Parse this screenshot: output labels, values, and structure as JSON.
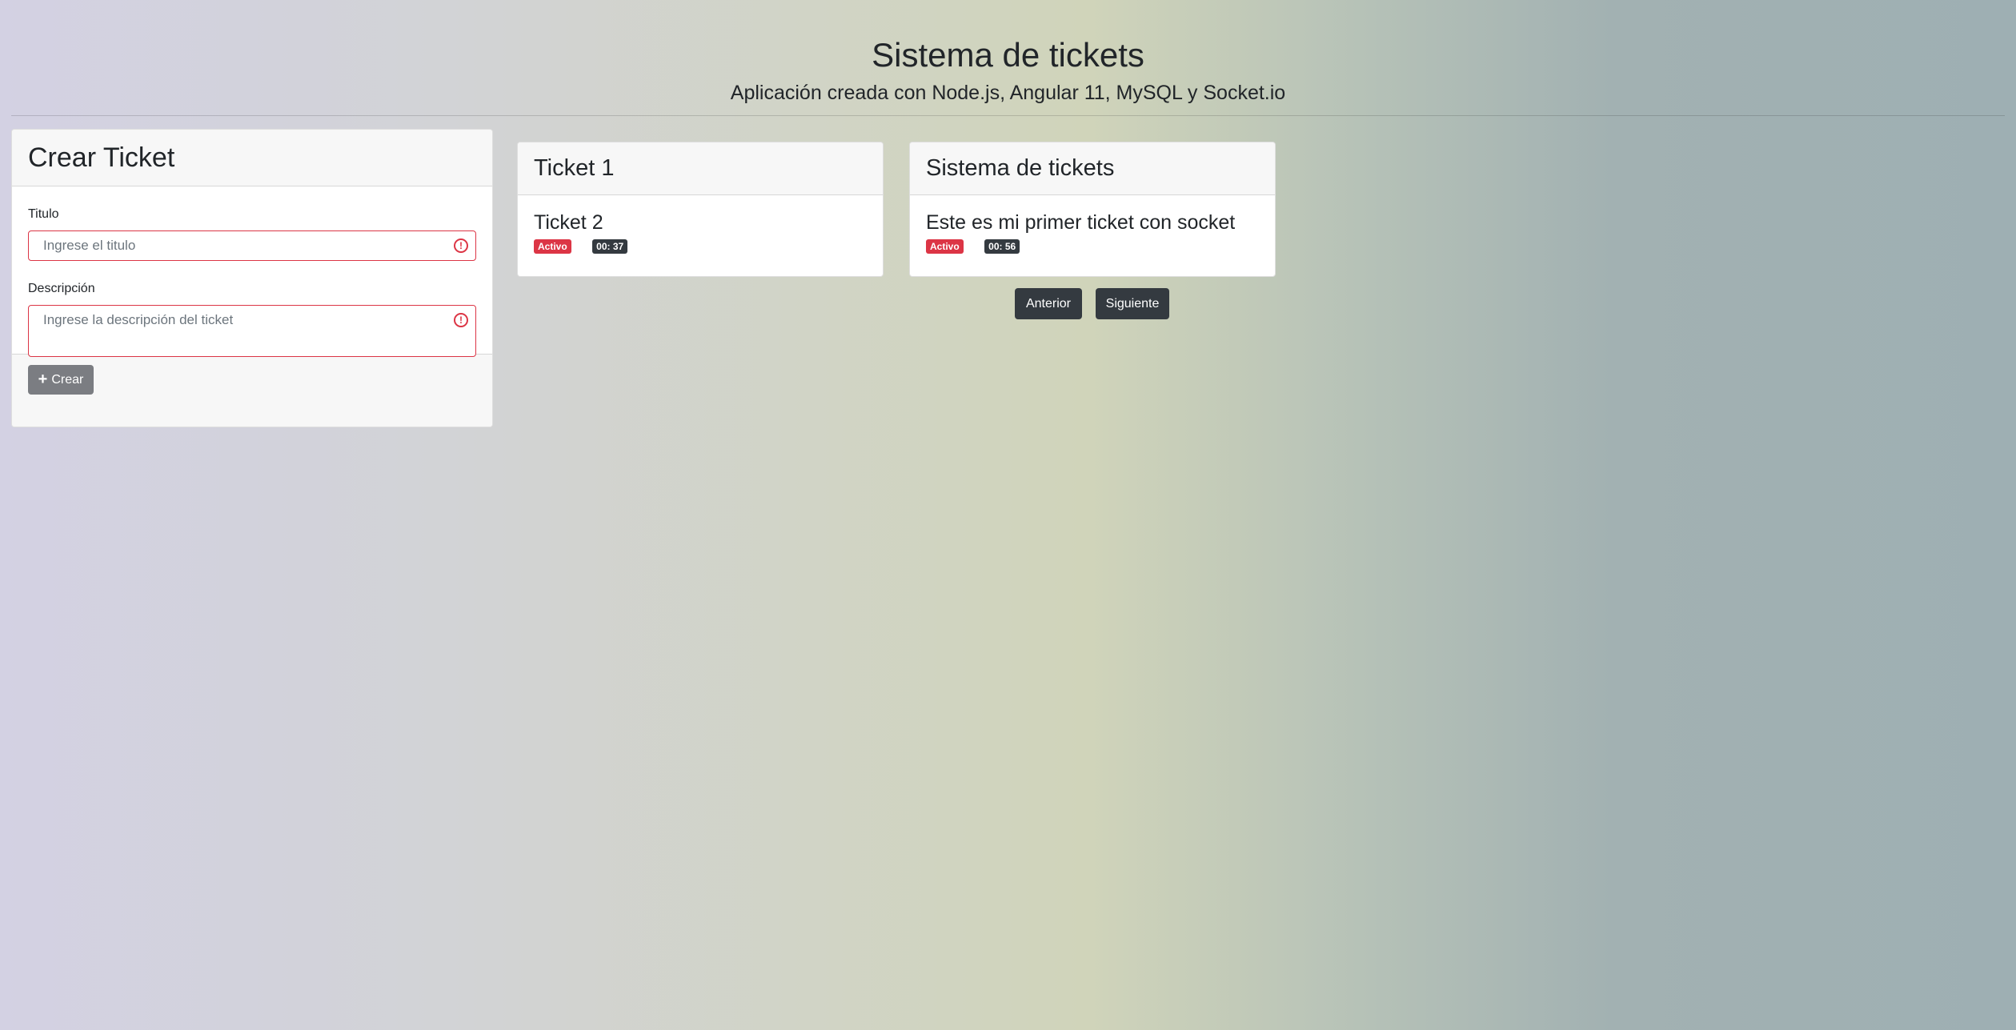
{
  "header": {
    "title": "Sistema de tickets",
    "subtitle": "Aplicación creada con Node.js, Angular 11, MySQL y Socket.io"
  },
  "create_form": {
    "title": "Crear Ticket",
    "title_label": "Titulo",
    "title_placeholder": "Ingrese el titulo",
    "description_label": "Descripción",
    "description_placeholder": "Ingrese la descripción del ticket",
    "submit_label": "Crear",
    "submit_icon": "plus-icon",
    "error_color": "#dc3545"
  },
  "tickets": [
    {
      "header": "Ticket 1",
      "title": "Ticket 2",
      "status": "Activo",
      "time": "00: 37"
    },
    {
      "header": "Sistema de tickets",
      "title": "Este es mi primer ticket con socket",
      "status": "Activo",
      "time": "00: 56"
    }
  ],
  "pagination": {
    "prev_label": "Anterior",
    "next_label": "Siguiente"
  }
}
